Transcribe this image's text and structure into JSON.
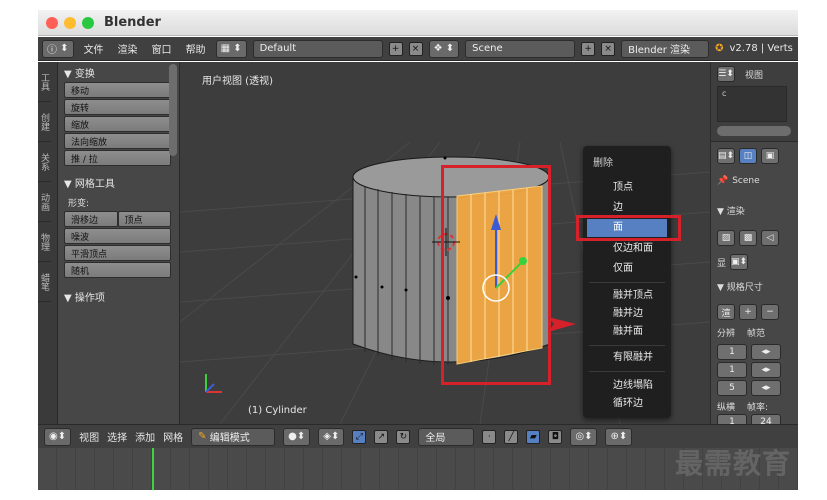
{
  "window": {
    "title": "Blender"
  },
  "topbar": {
    "menus": [
      "文件",
      "渲染",
      "窗口",
      "帮助"
    ],
    "layout": "Default",
    "scene": "Scene",
    "engine": "Blender 渲染",
    "version": "v2.78 | Verts"
  },
  "tool_tabs": [
    "工具",
    "创建",
    "关系",
    "动画",
    "物理",
    "蜡笔"
  ],
  "toolshelf": {
    "transform_header": "▼ 变换",
    "transform_items": [
      "移动",
      "旋转",
      "缩放",
      "法向缩放",
      "推 / 拉"
    ],
    "mesh_tools_header": "▼ 网格工具",
    "deform_label": "形变:",
    "slide_edge": "滑移边",
    "vertex": "顶点",
    "noise": "噪波",
    "smooth_vertex": "平滑顶点",
    "random": "随机",
    "operator_header": "▼ 操作项"
  },
  "viewport": {
    "label": "用户视图 (透视)",
    "object_label": "(1) Cylinder"
  },
  "context_menu": {
    "title": "删除",
    "items": [
      "顶点",
      "边",
      "面",
      "仅边和面",
      "仅面",
      "融并顶点",
      "融并边",
      "融并面",
      "有限融并",
      "边线塌陷",
      "循环边"
    ],
    "active_item": "面"
  },
  "properties": {
    "view_label": "视图",
    "scene": "Scene",
    "render_header": "▼ 渲染",
    "display_label": "显",
    "dimensions_header": "▼ 规格尺寸",
    "render_short": "渲",
    "resolution": "分辨",
    "frame_range": "帧范",
    "values": [
      "1",
      "1",
      "5",
      "1"
    ],
    "aspect": "纵横",
    "frame_rate": "帧率:",
    "fps": "24"
  },
  "bottombar": {
    "items": [
      "视图",
      "选择",
      "添加",
      "网格"
    ],
    "mode": "编辑模式",
    "pivot": "全局"
  },
  "watermark": "最需教育",
  "colors": {
    "accent": "#5680c2",
    "highlight_box": "#d6202a",
    "face_select": "#f0a640",
    "viewport_bg": "#3d3d3d"
  }
}
